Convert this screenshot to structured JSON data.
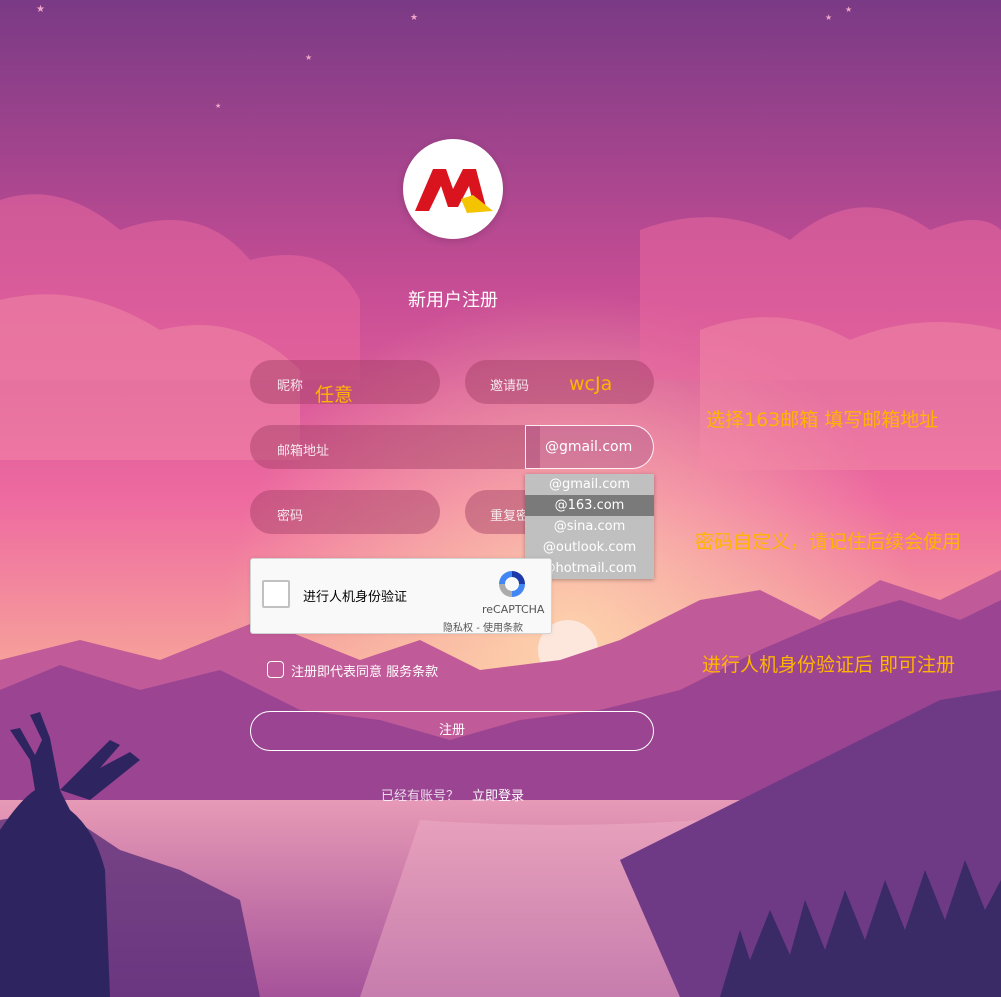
{
  "colors": {
    "accent_annotation": "#ffb400",
    "sky_top": "#7a3a85",
    "sky_mid": "#e9629a",
    "horizon": "#f5a89a",
    "mountain": "#8a3e88",
    "silhouette": "#3a2a66",
    "dropdown_bg": "#c0c0c0",
    "dropdown_selected": "#7a7a7a"
  },
  "logo": {
    "icon": "m-logo-icon"
  },
  "page": {
    "title": "新用户注册"
  },
  "form": {
    "nickname": {
      "label": "昵称",
      "value": "任意"
    },
    "invite": {
      "label": "邀请码",
      "value": "wcJa"
    },
    "email": {
      "label": "邮箱地址",
      "domain_selected": "@gmail.com"
    },
    "domain_options": [
      "@gmail.com",
      "@163.com",
      "@sina.com",
      "@outlook.com",
      "@hotmail.com"
    ],
    "password": {
      "label": "密码"
    },
    "confirm": {
      "label": "重复密"
    },
    "captcha": {
      "label": "进行人机身份验证",
      "brand": "reCAPTCHA",
      "privacy": "隐私权",
      "separator": "-",
      "terms": "使用条款",
      "icon": "recaptcha-icon"
    },
    "agree": {
      "text": "注册即代表同意",
      "link": "服务条款"
    },
    "submit_label": "注册",
    "login_question": "已经有账号？",
    "login_link": "立即登录"
  },
  "annotations": {
    "email_tip": "选择163邮箱 填写邮箱地址",
    "password_tip": "密码自定义，请记住后续会使用",
    "captcha_tip": "进行人机身份验证后 即可注册"
  }
}
